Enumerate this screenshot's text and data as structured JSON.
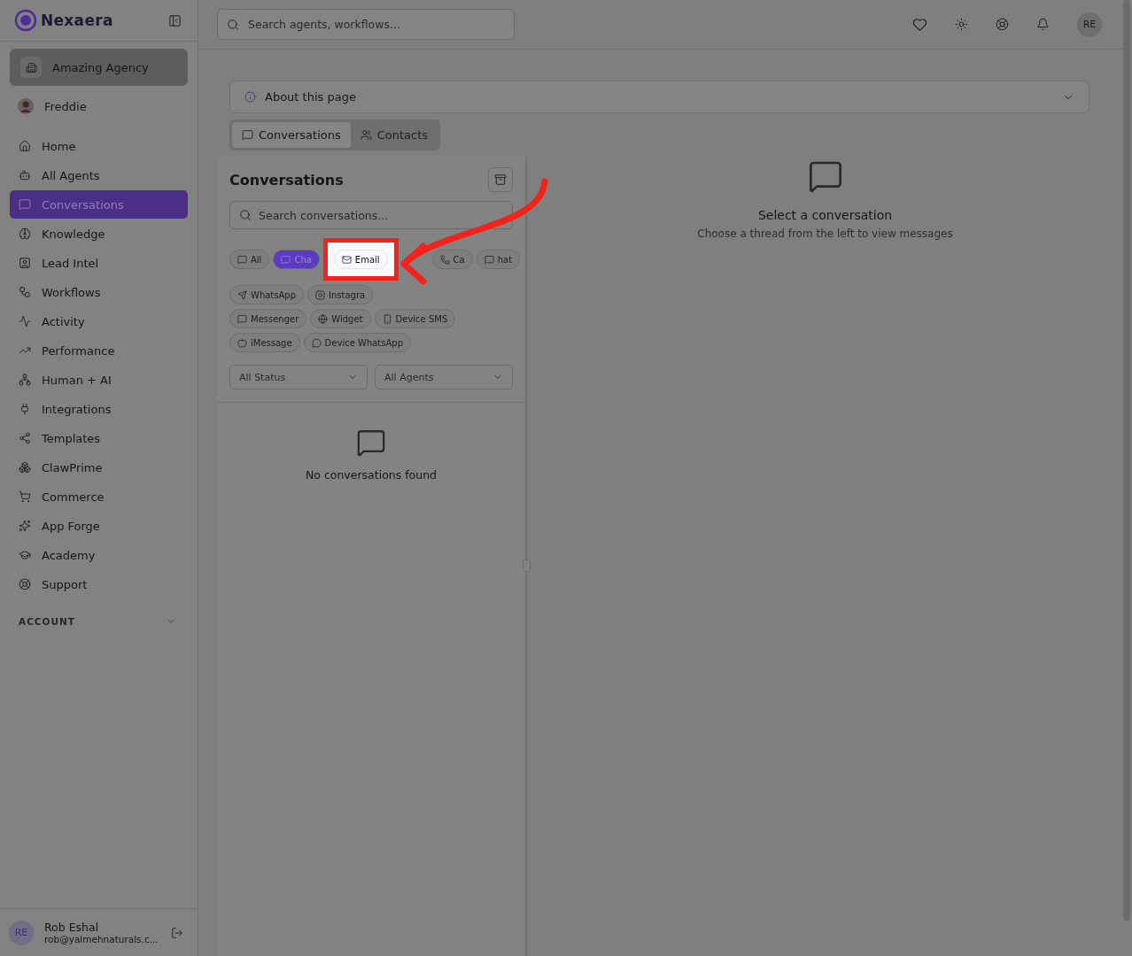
{
  "brand": {
    "name": "Nexaera"
  },
  "workspace": "Amazing Agency",
  "profile": "Freddie",
  "nav": [
    {
      "label": "Home",
      "selected": false
    },
    {
      "label": "All Agents",
      "selected": false
    },
    {
      "label": "Conversations",
      "selected": true
    },
    {
      "label": "Knowledge",
      "selected": false
    },
    {
      "label": "Lead Intel",
      "selected": false
    },
    {
      "label": "Workflows",
      "selected": false
    },
    {
      "label": "Activity",
      "selected": false
    },
    {
      "label": "Performance",
      "selected": false
    },
    {
      "label": "Human + AI",
      "selected": false
    },
    {
      "label": "Integrations",
      "selected": false
    },
    {
      "label": "Templates",
      "selected": false
    },
    {
      "label": "ClawPrime",
      "selected": false
    },
    {
      "label": "Commerce",
      "selected": false
    },
    {
      "label": "App Forge",
      "selected": false
    },
    {
      "label": "Academy",
      "selected": false
    },
    {
      "label": "Support",
      "selected": false
    }
  ],
  "account_section": {
    "label": "ACCOUNT",
    "expanded": false
  },
  "footer_user": {
    "initials": "RE",
    "name": "Rob Eshal",
    "email": "rob@yalmehnaturals.c..."
  },
  "search": {
    "placeholder": "Search agents, workflows..."
  },
  "user_avatar": "RE",
  "about": {
    "label": "About this page",
    "expanded": false
  },
  "tabs": [
    {
      "label": "Conversations",
      "selected": true
    },
    {
      "label": "Contacts",
      "selected": false
    }
  ],
  "list_panel": {
    "title": "Conversations",
    "search_placeholder": "Search conversations...",
    "chip_rows": [
      [
        {
          "label": "All",
          "selected": false,
          "highlighted": false
        },
        {
          "label": "Cha",
          "selected": true,
          "highlighted": false
        },
        {
          "label": "Email",
          "selected": false,
          "highlighted": true
        },
        {
          "label": "Ca",
          "selected": false,
          "highlighted": false
        },
        {
          "label": "hat",
          "selected": false,
          "highlighted": false
        }
      ],
      [
        {
          "label": "WhatsApp",
          "selected": false,
          "highlighted": false
        },
        {
          "label": "Instagra",
          "selected": false,
          "highlighted": false
        }
      ],
      [
        {
          "label": "Messenger",
          "selected": false,
          "highlighted": false
        },
        {
          "label": "Widget",
          "selected": false,
          "highlighted": false
        },
        {
          "label": "Device SMS",
          "selected": false,
          "highlighted": false
        }
      ],
      [
        {
          "label": "iMessage",
          "selected": false,
          "highlighted": false
        },
        {
          "label": "Device WhatsApp",
          "selected": false,
          "highlighted": false
        }
      ]
    ],
    "filters": [
      "All Status",
      "All Agents"
    ],
    "empty": "No conversations found"
  },
  "detail": {
    "title": "Select a conversation",
    "subtitle": "Choose a thread from the left to view messages"
  }
}
